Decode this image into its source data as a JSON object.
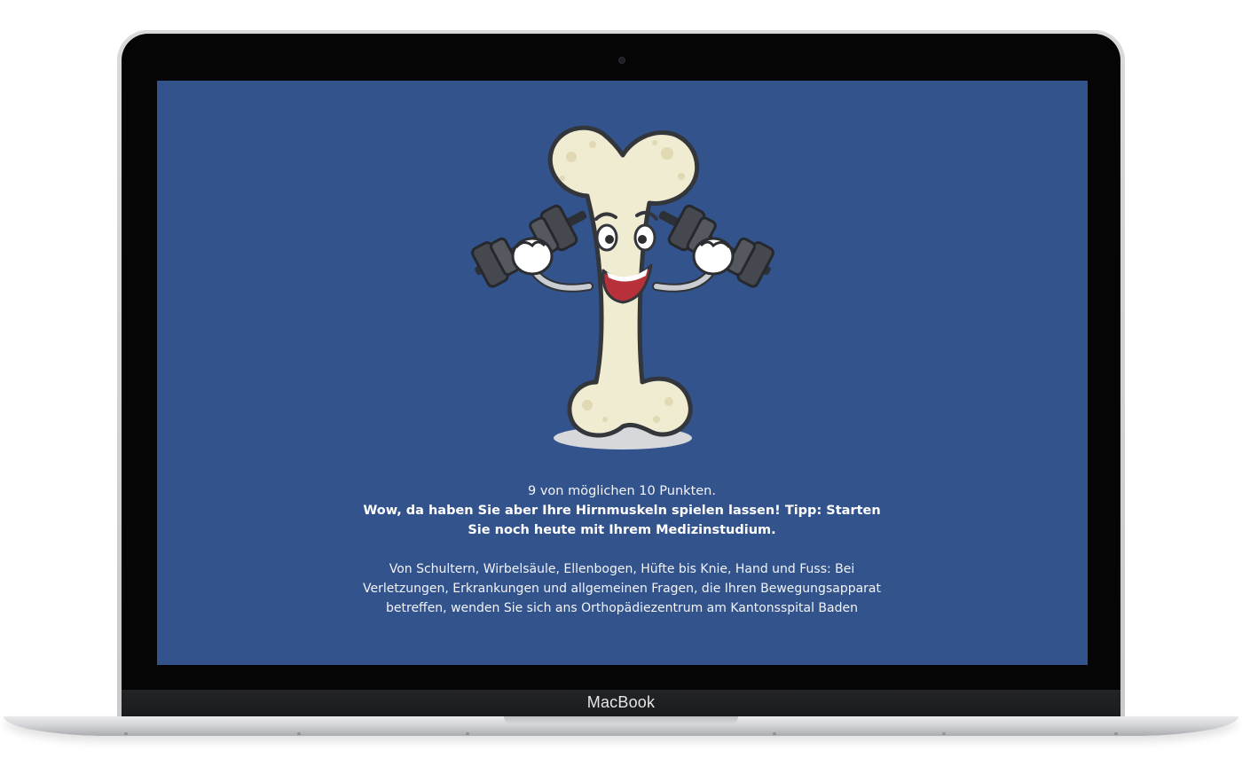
{
  "device": {
    "brand_label": "MacBook"
  },
  "quiz_result": {
    "score_text": "9 von möglichen 10 Punkten.",
    "headline": "Wow, da haben Sie aber Ihre Hirnmuskeln spielen lassen! Tipp: Starten Sie noch heute mit Ihrem Medizinstudium.",
    "body": "Von Schultern, Wirbelsäule, Ellenbogen, Hüfte bis Knie, Hand und Fuss: Bei Verletzungen, Erkrankungen und allgemeinen Fragen, die Ihren Bewegungsapparat betreffen, wenden Sie sich ans Orthopädiezentrum am Kantonsspital Baden"
  },
  "mascot": {
    "icon": "bone-mascot-with-dumbbells-icon"
  },
  "colors": {
    "screen_background": "#33538c",
    "text": "#f2f4f8",
    "bone": "#f0ecd2",
    "dumbbell": "#3f4349"
  }
}
